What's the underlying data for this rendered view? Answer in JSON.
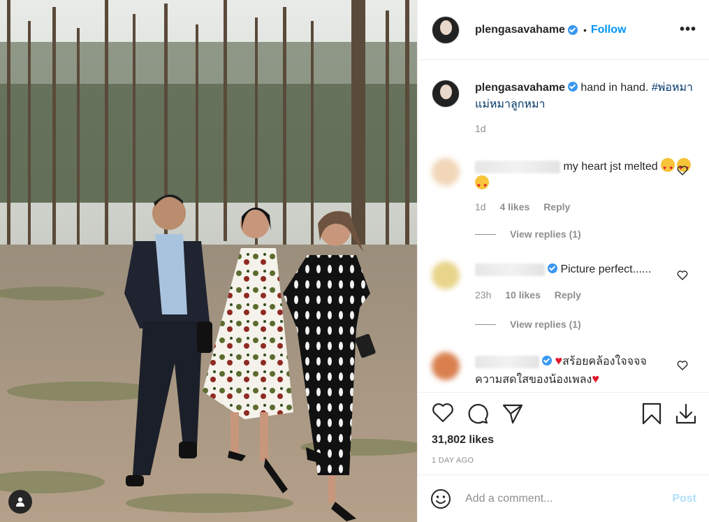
{
  "post": {
    "username": "plengasavahame",
    "follow_label": "Follow",
    "more_label": "•••",
    "caption_text": "hand in hand.",
    "caption_hashtag": "#พ่อหมาแม่หมาลูกหมา",
    "caption_time": "1d"
  },
  "comments": [
    {
      "text": "my heart jst melted",
      "emoji": "🤩🤩🤩",
      "time": "1d",
      "likes": "4 likes",
      "reply": "Reply",
      "view_replies": "View replies (1)",
      "avatar_color": "#f1d6b8"
    },
    {
      "text": "Picture perfect......",
      "time": "23h",
      "likes": "10 likes",
      "reply": "Reply",
      "view_replies": "View replies (1)",
      "avatar_color": "#e8d48a"
    },
    {
      "text_line1": "สร้อยคล้องใจจจจ",
      "text_line2": "ความสดใสของน้องเพลง",
      "avatar_color": "#d9804e"
    }
  ],
  "footer": {
    "likes": "31,802 likes",
    "time_ago": "1 DAY AGO",
    "comment_placeholder": "Add a comment...",
    "post_label": "Post"
  },
  "colors": {
    "link": "#0095f6",
    "verified": "#3897f0",
    "muted": "#8e8e8e"
  }
}
